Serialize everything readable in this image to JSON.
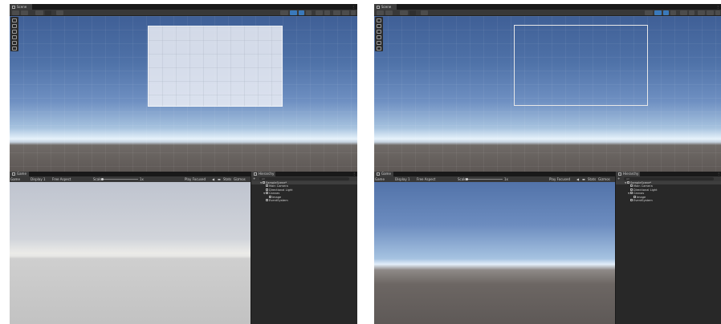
{
  "panels": [
    {
      "id": "left",
      "scene_tab": "Scene",
      "game_tab": "Game",
      "hierarchy_tab": "Hierarchy",
      "display": "Display 1",
      "aspect": "Free Aspect",
      "scale_label": "Scale",
      "scale_value": "1x",
      "play_mode": "Play Focused",
      "mute_icon": "speaker-icon",
      "stats": "Stats",
      "gizmos": "Gizmos",
      "hierarchy_add": "+",
      "hierarchy_search": "All",
      "hierarchy": [
        {
          "label": "SampleScene*",
          "depth": 0,
          "expand": "▼",
          "icon": "unity-scene-icon"
        },
        {
          "label": "Main Camera",
          "depth": 1,
          "expand": "",
          "icon": "gameobject-icon"
        },
        {
          "label": "Directional Light",
          "depth": 1,
          "expand": "",
          "icon": "gameobject-icon"
        },
        {
          "label": "Canvas",
          "depth": 1,
          "expand": "▼",
          "icon": "gameobject-icon"
        },
        {
          "label": "Image",
          "depth": 2,
          "expand": "",
          "icon": "gameobject-icon"
        },
        {
          "label": "EventSystem",
          "depth": 1,
          "expand": "",
          "icon": "gameobject-icon"
        }
      ],
      "canvas_style": "filled",
      "game_view_style": "gray"
    },
    {
      "id": "right",
      "scene_tab": "Scene",
      "game_tab": "Game",
      "hierarchy_tab": "Hierarchy",
      "display": "Display 1",
      "aspect": "Free Aspect",
      "scale_label": "Scale",
      "scale_value": "1x",
      "play_mode": "Play Focused",
      "mute_icon": "speaker-icon",
      "stats": "Stats",
      "gizmos": "Gizmos",
      "hierarchy_add": "+",
      "hierarchy_search": "All",
      "hierarchy": [
        {
          "label": "SampleScene*",
          "depth": 0,
          "expand": "▼",
          "icon": "unity-scene-icon"
        },
        {
          "label": "Main Camera",
          "depth": 1,
          "expand": "",
          "icon": "gameobject-icon"
        },
        {
          "label": "Directional Light",
          "depth": 1,
          "expand": "",
          "icon": "gameobject-icon"
        },
        {
          "label": "Canvas",
          "depth": 1,
          "expand": "▼",
          "icon": "gameobject-icon"
        },
        {
          "label": "Image",
          "depth": 2,
          "expand": "",
          "icon": "gameobject-icon"
        },
        {
          "label": "EventSystem",
          "depth": 1,
          "expand": "",
          "icon": "gameobject-icon"
        }
      ],
      "canvas_style": "outline",
      "game_view_style": "scene"
    }
  ],
  "colors": {
    "editor_bg": "#282828",
    "toolbar_bg": "#383838",
    "active_tool": "#3a79bb"
  },
  "icons": {
    "menu": "⋮",
    "tools": [
      "hand-tool-icon",
      "move-tool-icon",
      "rotate-tool-icon",
      "scale-tool-icon",
      "rect-tool-icon",
      "transform-tool-icon"
    ]
  }
}
